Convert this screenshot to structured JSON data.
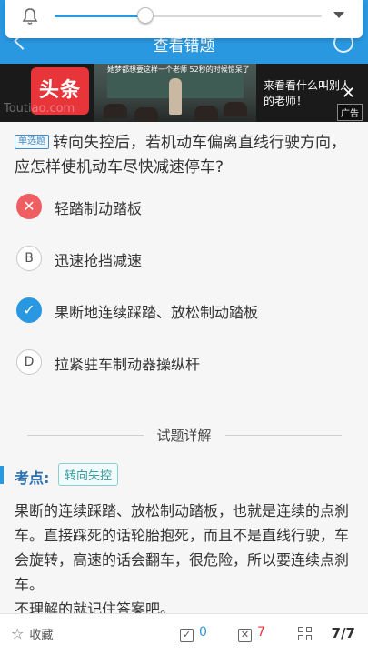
{
  "header": {
    "title": "查看错题"
  },
  "brightness": {
    "level": 0.34
  },
  "ad": {
    "logo_text": "头条",
    "watermark": "Toutiao.com",
    "caption": "她梦都想要这样一个老师 52秒的时候惊呆了",
    "text": "来看看什么叫别人的老师！",
    "badge": "广告",
    "close": "✕"
  },
  "question": {
    "type_label": "单选题",
    "text": "转向失控后，若机动车偏离直线行驶方向，应怎样使机动车尽快减速停车?"
  },
  "options": [
    {
      "marker": "✕",
      "text": "轻踏制动踏板",
      "state": "wrong"
    },
    {
      "marker": "B",
      "text": "迅速抢挡减速",
      "state": "normal"
    },
    {
      "marker": "✓",
      "text": "果断地连续踩踏、放松制动踏板",
      "state": "right"
    },
    {
      "marker": "D",
      "text": "拉紧驻车制动器操纵杆",
      "state": "normal"
    }
  ],
  "explanation": {
    "section_title": "试题详解",
    "kp_label": "考点:",
    "kp_tag": "转向失控",
    "paragraph1": "果断的连续踩踏、放松制动踏板，也就是连续的点刹车。直接踩死的话轮胎抱死，而且不是直线行驶，车会旋转，高速的话会翻车，很危险，所以要连续点刹车。",
    "paragraph2": "不理解的就记住答案吧。"
  },
  "bottom": {
    "fav_label": "收藏",
    "correct_count": "0",
    "wrong_count": "7",
    "page": "7/7",
    "correct_color": "#2a98e0",
    "wrong_color": "#e8353a"
  }
}
